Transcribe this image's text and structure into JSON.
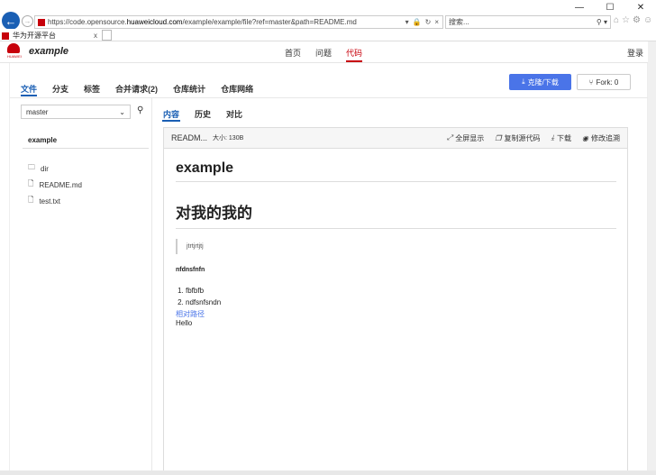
{
  "browser": {
    "url_prefix": "https://code.opensource.",
    "url_domain": "huaweicloud.com",
    "url_suffix": "/example/example/file?ref=master&path=README.md",
    "search_placeholder": "搜索...",
    "tab_title": "华为开源平台",
    "tab_close": "x",
    "win_min": "—",
    "win_max": "☐",
    "win_close": "✕"
  },
  "header": {
    "logo_text": "HUAWEI",
    "project": "example",
    "nav": [
      "首页",
      "问题",
      "代码"
    ],
    "login": "登录"
  },
  "repo": {
    "tabs": [
      "文件",
      "分支",
      "标签",
      "合并请求(2)",
      "仓库统计",
      "仓库网络"
    ],
    "clone_label": "克隆/下载",
    "fork_label": "Fork: 0"
  },
  "tree": {
    "branch": "master",
    "title": "example",
    "items": [
      "dir",
      "README.md",
      "test.txt"
    ]
  },
  "file": {
    "tabs": [
      "内容",
      "历史",
      "对比"
    ],
    "name": "READM...",
    "size": "大小: 130B",
    "actions": [
      "全屏显示",
      "复制源代码",
      "下载",
      "修改追溯"
    ]
  },
  "markdown": {
    "h1": "example",
    "h1b": "对我的我的",
    "quote": "jtrtjrtjtj",
    "h4": "nfdnsfnfn",
    "list": [
      "fbfbfb",
      "ndfsnfsndn"
    ],
    "link": "相对路径",
    "text": "Hello"
  },
  "colors": {
    "brand_red": "#c7000b",
    "accent_blue": "#4a74e8",
    "tab_blue": "#1a5fb4"
  }
}
